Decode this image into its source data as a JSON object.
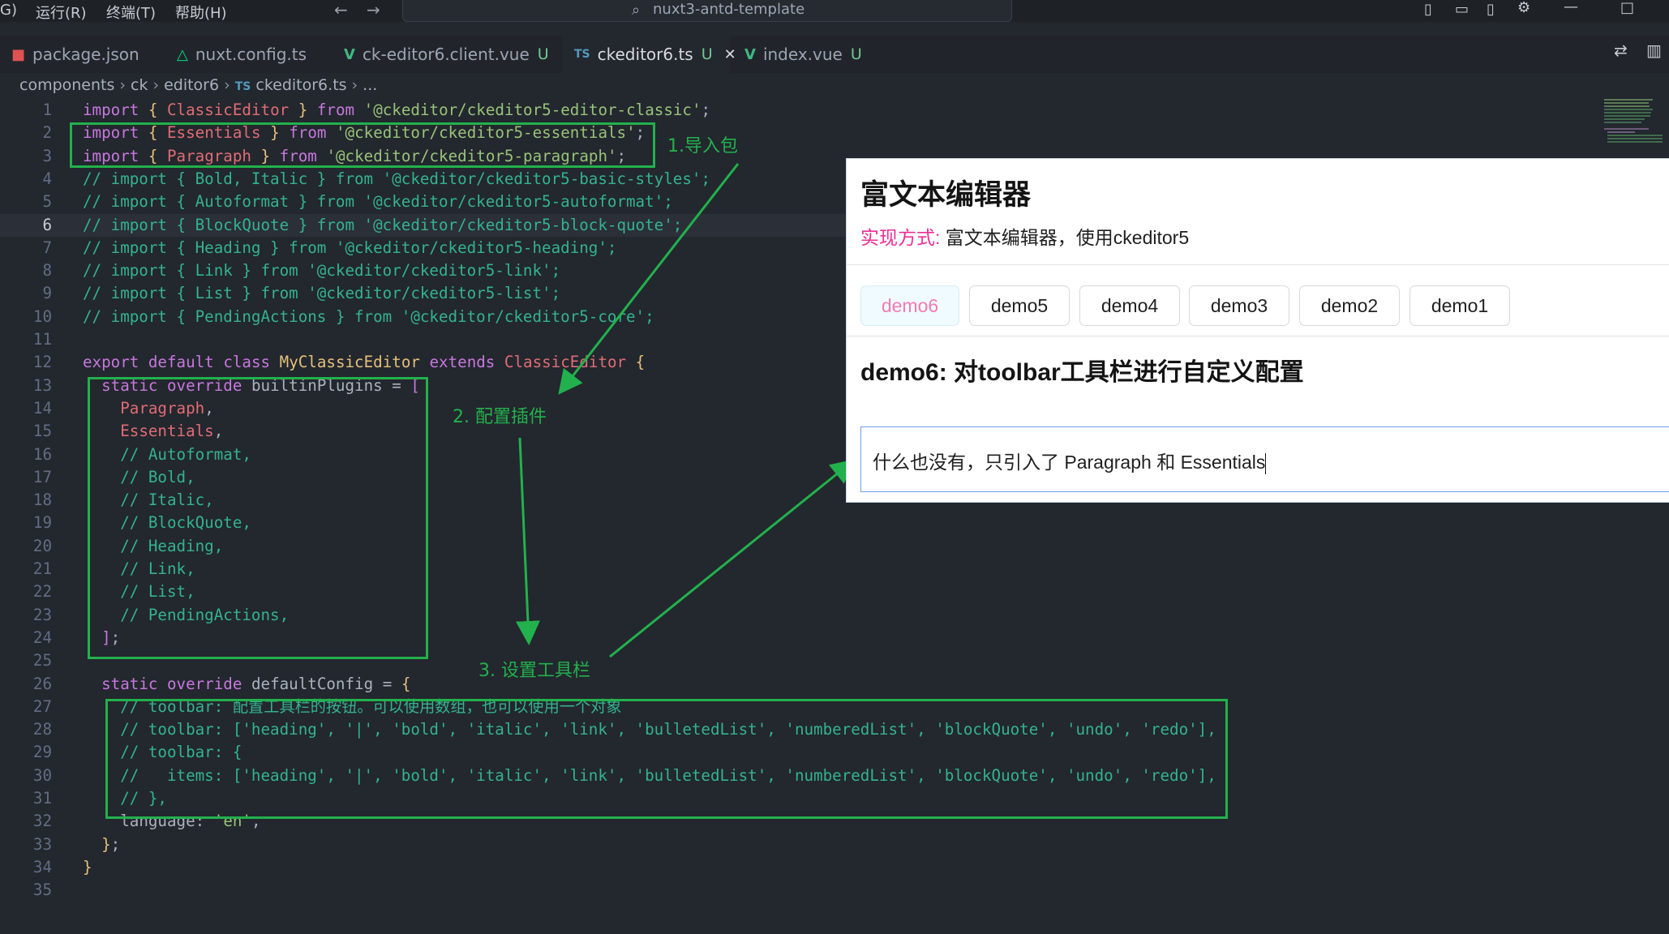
{
  "menu": {
    "items": [
      "G)",
      "运行(R)",
      "终端(T)",
      "帮助(H)"
    ]
  },
  "command_center": {
    "text": "nuxt3-antd-template"
  },
  "tabs": [
    {
      "label": "package.json",
      "icon": "npm-icon",
      "modified": ""
    },
    {
      "label": "nuxt.config.ts",
      "icon": "nuxt-icon",
      "modified": ""
    },
    {
      "label": "ck-editor6.client.vue",
      "icon": "vue-icon",
      "modified": "U"
    },
    {
      "label": "ckeditor6.ts",
      "icon": "ts-icon",
      "modified": "U",
      "active": true
    },
    {
      "label": "index.vue",
      "icon": "vue-icon",
      "modified": "U"
    }
  ],
  "breadcrumb": [
    "components",
    "ck",
    "editor6",
    "ckeditor6.ts",
    "..."
  ],
  "breadcrumb_ts_badge": "TS",
  "code": {
    "current_line": 6,
    "lines": [
      "import { ClassicEditor } from '@ckeditor/ckeditor5-editor-classic';",
      "import { Essentials } from '@ckeditor/ckeditor5-essentials';",
      "import { Paragraph } from '@ckeditor/ckeditor5-paragraph';",
      "// import { Bold, Italic } from '@ckeditor/ckeditor5-basic-styles';",
      "// import { Autoformat } from '@ckeditor/ckeditor5-autoformat';",
      "// import { BlockQuote } from '@ckeditor/ckeditor5-block-quote';",
      "// import { Heading } from '@ckeditor/ckeditor5-heading';",
      "// import { Link } from '@ckeditor/ckeditor5-link';",
      "// import { List } from '@ckeditor/ckeditor5-list';",
      "// import { PendingActions } from '@ckeditor/ckeditor5-core';",
      "",
      "export default class MyClassicEditor extends ClassicEditor {",
      "  static override builtinPlugins = [",
      "    Paragraph,",
      "    Essentials,",
      "    // Autoformat,",
      "    // Bold,",
      "    // Italic,",
      "    // BlockQuote,",
      "    // Heading,",
      "    // Link,",
      "    // List,",
      "    // PendingActions,",
      "  ];",
      "",
      "  static override defaultConfig = {",
      "    // toolbar: 配置工具栏的按钮。可以使用数组，也可以使用一个对象",
      "    // toolbar: ['heading', '|', 'bold', 'italic', 'link', 'bulletedList', 'numberedList', 'blockQuote', 'undo', 'redo'],",
      "    // toolbar: {",
      "    //   items: ['heading', '|', 'bold', 'italic', 'link', 'bulletedList', 'numberedList', 'blockQuote', 'undo', 'redo'],",
      "    // },",
      "    language: 'en',",
      "  };",
      "}",
      ""
    ]
  },
  "annotations": {
    "step1": "1.导入包",
    "step2": "2. 配置插件",
    "step3": "3. 设置工具栏"
  },
  "preview": {
    "title": "富文本编辑器",
    "sub_label": "实现方式:",
    "sub_text": "富文本编辑器，使用ckeditor5",
    "demos": [
      "demo6",
      "demo5",
      "demo4",
      "demo3",
      "demo2",
      "demo1"
    ],
    "selected_demo": "demo6",
    "heading": "demo6: 对toolbar工具栏进行自定义配置",
    "editor_text": "什么也没有，只引入了 Paragraph 和 Essentials"
  },
  "colors": {
    "annotation": "#22b14c",
    "accent_pink": "#eb2f96",
    "editor_bg": "#23272e"
  }
}
